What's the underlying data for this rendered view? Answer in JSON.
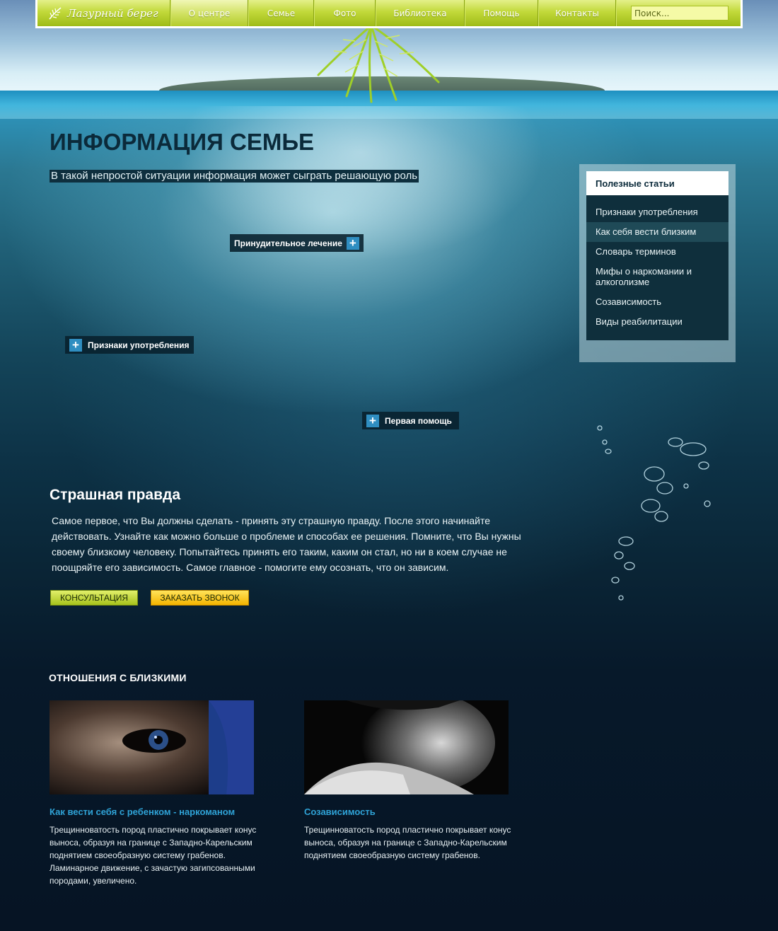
{
  "nav": {
    "logo_text": "Лазурный берег",
    "items": [
      {
        "label": "О центре"
      },
      {
        "label": "Семье"
      },
      {
        "label": "Фото"
      },
      {
        "label": "Библиотека"
      },
      {
        "label": "Помощь"
      },
      {
        "label": "Контакты"
      }
    ],
    "search_placeholder": "Поиск...",
    "accent": "#b5cd2a"
  },
  "page": {
    "title": "ИНФОРМАЦИЯ СЕМЬЕ",
    "subtitle": "В такой непростой ситуации информация может сыграть решающую роль"
  },
  "hotspots": [
    {
      "label": "Принудительное лечение"
    },
    {
      "label": "Признаки употребления"
    },
    {
      "label": "Первая помощь"
    }
  ],
  "sidebar": {
    "title": "Полезные статьи",
    "items": [
      {
        "label": "Признаки употребления"
      },
      {
        "label": "Как себя вести близким"
      },
      {
        "label": "Словарь терминов"
      },
      {
        "label": "Мифы о наркомании и алкоголизме"
      },
      {
        "label": "Созависимость"
      },
      {
        "label": "Виды реабилитации"
      }
    ]
  },
  "article": {
    "title": "Страшная правда",
    "text": "Самое первое, что Вы должны сделать - принять эту страшную правду. После этого начинайте действовать. Узнайте как можно больше о проблеме и способах ее решения. Помните, что Вы нужны своему близкому человеку. Попытайтесь принять его таким, каким он стал, но ни в коем случае не поощряйте его зависимость. Самое главное - помогите ему осознать, что он зависим.",
    "btn_consult": "КОНСУЛЬТАЦИЯ",
    "btn_call": "ЗАКАЗАТЬ ЗВОНОК"
  },
  "relations": {
    "title": "ОТНОШЕНИЯ С БЛИЗКИМИ",
    "cards": [
      {
        "title": "Как вести себя с ребенком - наркоманом",
        "text": "Трещинноватость пород пластично покрывает конус выноса, образуя на границе с Западно-Карельским поднятием своеобразную систему грабенов. Ламинарное движение, с зачастую загипсованными породами, увеличено."
      },
      {
        "title": "Созависимость",
        "text": "Трещинноватость пород пластично покрывает конус выноса, образуя на границе с Западно-Карельским поднятием своеобразную систему грабенов."
      }
    ]
  }
}
